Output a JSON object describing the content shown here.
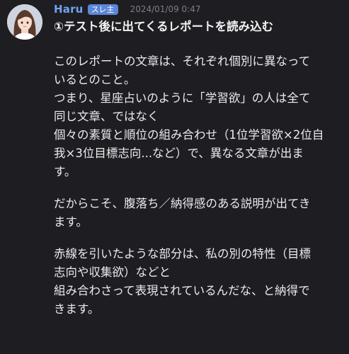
{
  "post": {
    "username": "Haru",
    "badge": "スレ主",
    "timestamp": "2024/01/09 0:47",
    "title": "①テスト後に出てくるレポートを読み込む",
    "paragraphs": [
      {
        "lines": [
          "このレポートの文章は、それぞれ個別に異なって",
          "いるとのこと。",
          "つまり、星座占いのように「学習欲」の人は全て",
          "同じ文章、ではなく",
          "個々の素質と順位の組み合わせ（1位学習欲×2位自",
          "我×3位目標志向...など）で、異なる文章が出ま",
          "す。"
        ]
      },
      {
        "lines": [
          "だからこそ、腹落ち／納得感のある説明が出てき",
          "ます。"
        ]
      },
      {
        "lines": [
          "赤線を引いたような部分は、私の別の特性（目標",
          "志向や収集欲）などと",
          "組み合わさって表現されているんだな、と納得で",
          "きます。"
        ]
      }
    ]
  },
  "colors": {
    "background": "#1e1e22",
    "username": "#6fa3f0",
    "badge_bg": "#5b86d9",
    "timestamp": "#7d7d85",
    "text": "#ebebee"
  },
  "icons": {
    "avatar": "avatar-illustration-woman"
  }
}
